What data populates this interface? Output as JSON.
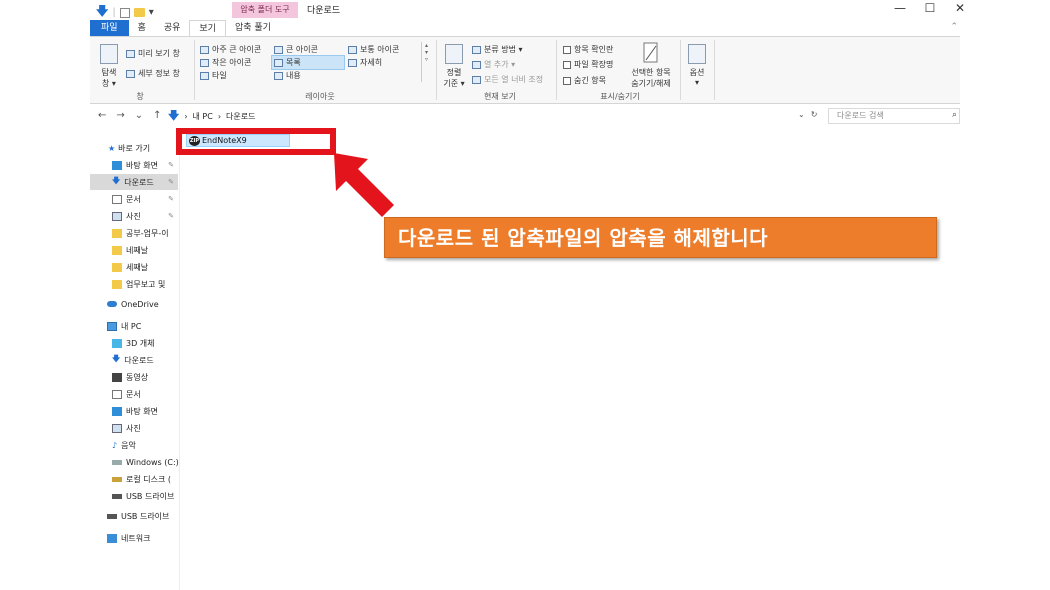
{
  "titlebar": {
    "context_tab": "압축 폴더 도구",
    "window_title": "다운로드",
    "minimize": "—",
    "maximize": "☐",
    "close": "✕"
  },
  "tabs": {
    "file": "파일",
    "home": "홈",
    "share": "공유",
    "view": "보기",
    "extract": "압축 풀기"
  },
  "ribbon": {
    "pane": {
      "nav_pane": "탐색",
      "nav_pane2": "창 ▾",
      "preview": "미리 보기 창",
      "details": "세부 정보 창",
      "label": "창"
    },
    "layout": {
      "extra_large": "아주 큰 아이콘",
      "large": "큰 아이콘",
      "medium": "보통 아이콘",
      "small": "작은 아이콘",
      "list": "목록",
      "details": "자세히",
      "tiles": "타일",
      "content": "내용",
      "label": "레이아웃"
    },
    "current_view": {
      "sort_by": "정렬",
      "sort_by2": "기준 ▾",
      "group_by": "분류 방법 ▾",
      "add_columns": "열 추가 ▾",
      "size_all": "모든 열 너비 조정",
      "label": "현재 보기"
    },
    "show_hide": {
      "item_checkboxes": "항목 확인란",
      "file_extensions": "파일 확장명",
      "hidden_items": "숨긴 항목",
      "hide_selected": "선택한 항목",
      "hide_selected2": "숨기기/해제",
      "label": "표시/숨기기"
    },
    "options": "옵션"
  },
  "address": {
    "nav_back": "←",
    "nav_forward": "→",
    "nav_recent": "⌄",
    "nav_up": "↑",
    "path_root": "내 PC",
    "path_sep": "›",
    "path_current": "다운로드",
    "refresh": "↻",
    "dropdown": "⌄",
    "search_placeholder": "다운로드 검색"
  },
  "sidebar": {
    "quick_access": "바로 가기",
    "items": [
      {
        "label": "바탕 화면",
        "pinned": true
      },
      {
        "label": "다운로드",
        "pinned": true
      },
      {
        "label": "문서",
        "pinned": true
      },
      {
        "label": "사진",
        "pinned": true
      },
      {
        "label": "공부-업무-이",
        "pinned": false
      },
      {
        "label": "네째날",
        "pinned": false
      },
      {
        "label": "세째날",
        "pinned": false
      },
      {
        "label": "업무보고 및",
        "pinned": false
      }
    ],
    "onedrive": "OneDrive",
    "this_pc": "내 PC",
    "pc_items": [
      {
        "label": "3D 개체"
      },
      {
        "label": "다운로드"
      },
      {
        "label": "동영상"
      },
      {
        "label": "문서"
      },
      {
        "label": "바탕 화면"
      },
      {
        "label": "사진"
      },
      {
        "label": "음악"
      },
      {
        "label": "Windows (C:)"
      },
      {
        "label": "로컬 디스크 ("
      },
      {
        "label": "USB 드라이브"
      }
    ],
    "usb_drive": "USB 드라이브",
    "network": "네트워크",
    "pin_glyph": "📌"
  },
  "content": {
    "file_name": "EndNoteX9",
    "zip_badge": "ZIP"
  },
  "annotation": {
    "callout_text": "다운로드 된 압축파일의 압축을 해제합니다"
  },
  "colors": {
    "accent": "#1f6fd1",
    "callout_bg": "#ee7d2b",
    "highlight_border": "#e3141b",
    "arrow_fill": "#e3141b"
  }
}
